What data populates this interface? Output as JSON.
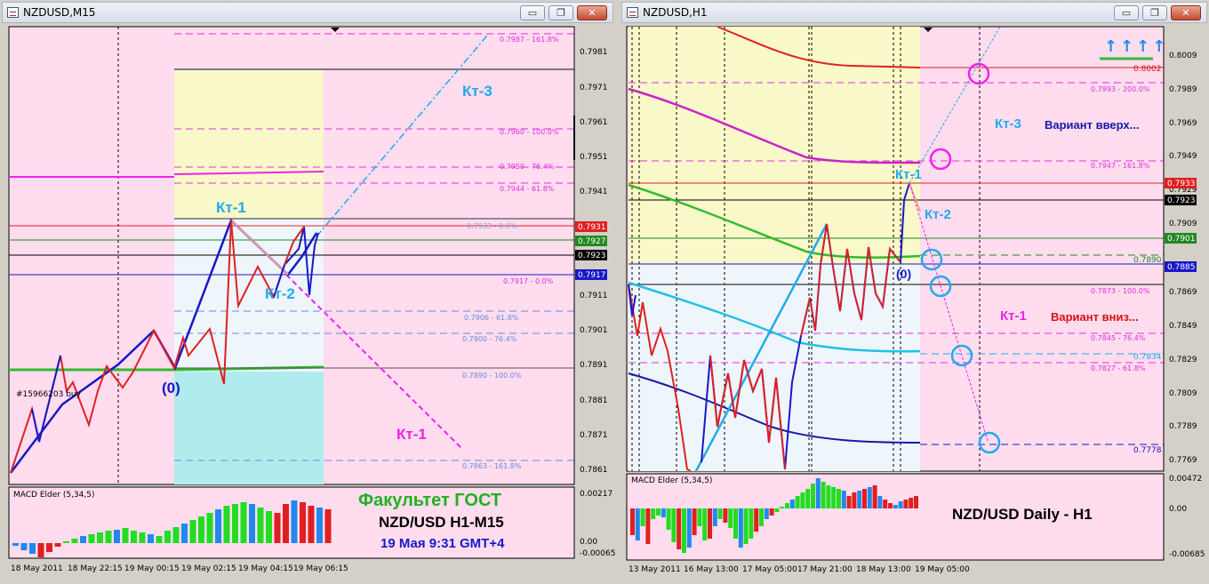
{
  "left_window": {
    "title": "NZDUSD,M15",
    "buttons": {
      "minimize": "▭",
      "maximize": "❐",
      "close": "✕"
    },
    "price_labels": [
      "0.7981",
      "0.7971",
      "0.7961",
      "0.7951",
      "0.7941",
      "0.7911",
      "0.7901",
      "0.7891",
      "0.7881",
      "0.7871",
      "0.7861"
    ],
    "tag_labels": [
      "0.7931",
      "0.7927",
      "0.7923",
      "0.7917"
    ],
    "fib_labels": [
      "0.7987 - 161.8%",
      "0.7960 - 100.0%",
      "0.7950 - 76.4%",
      "0.7944 - 61.8%",
      "0.7933 - 0.0%",
      "0.7917 - 0.0%",
      "0.7906 - 61.8%",
      "0.7900 - 76.4%",
      "0.7890 - 100.0%",
      "0.7863 - 161.8%"
    ],
    "time_labels": [
      "18 May 2011",
      "18 May 22:15",
      "19 May 00:15",
      "19 May 02:15",
      "19 May 04:15",
      "19 May 06:15"
    ],
    "annotations": {
      "kt1": "Кт-1",
      "kt2": "Кт-2",
      "kt3": "Кт-3",
      "kt1_target": "Кт-1",
      "zero": "(0)",
      "order": "#15966203 buy"
    },
    "macd": {
      "label": "MACD Elder (5,34,5)",
      "max": "0.00217",
      "zero": "0.00",
      "min": "-0.00065"
    },
    "overlay": {
      "line1": "Факультет ГОСТ",
      "line2": "NZD/USD H1-M15",
      "line3": "19 Мая 9:31 GMT+4"
    }
  },
  "right_window": {
    "title": "NZDUSD,H1",
    "buttons": {
      "minimize": "▭",
      "maximize": "❐",
      "close": "✕"
    },
    "price_labels": [
      "0.8009",
      "0.7989",
      "0.7969",
      "0.7949",
      "0.7929",
      "0.7909",
      "0.7869",
      "0.7849",
      "0.7829",
      "0.7809",
      "0.7789",
      "0.7769"
    ],
    "tag_labels": [
      "0.8002",
      "0.7933",
      "0.7923",
      "0.7901",
      "0.7890",
      "0.7885",
      "0.7834",
      "0.7778"
    ],
    "fib_labels": [
      "0.7993 - 200.0%",
      "0.7947 - 161.8%",
      "0.7873 - 100.0%",
      "0.7845 - 76.4%",
      "0.7827 - 61.8%"
    ],
    "time_labels": [
      "13 May 2011",
      "16 May 13:00",
      "17 May 05:00",
      "17 May 21:00",
      "18 May 13:00",
      "19 May 05:00"
    ],
    "annotations": {
      "kt1_top": "Кт-1",
      "kt2": "Кт-2",
      "kt3": "Кт-3",
      "kt1": "Кт-1",
      "zero": "(0)",
      "up": "Вариант вверх...",
      "down": "Вариант вниз...",
      "arrows": "↑↑↑↑"
    },
    "macd": {
      "label": "MACD Elder (5,34,5)",
      "max": "0.00472",
      "zero": "0.00",
      "min": "-0.00685"
    },
    "overlay": {
      "line1": "NZD/USD Daily - H1"
    }
  }
}
